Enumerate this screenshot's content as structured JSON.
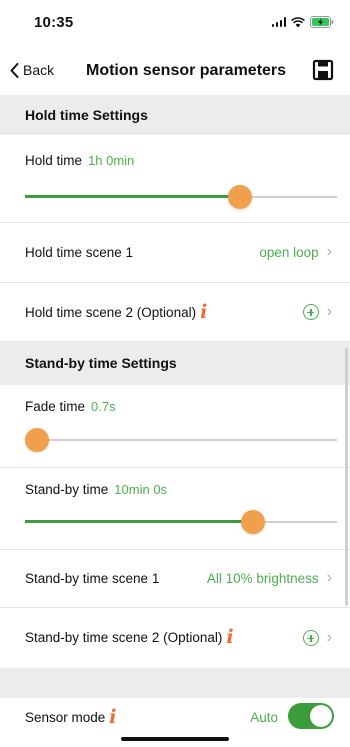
{
  "status_bar": {
    "time": "10:35"
  },
  "nav": {
    "back_label": "Back",
    "title": "Motion sensor parameters",
    "save_icon": "floppy-disk-icon"
  },
  "hold_section": {
    "header": "Hold time Settings",
    "hold_time": {
      "label": "Hold time",
      "value": "1h 0min",
      "slider_fraction": 0.69
    },
    "scene1": {
      "label": "Hold time scene 1",
      "value": "open loop"
    },
    "scene2": {
      "label": "Hold time scene 2 (Optional)"
    }
  },
  "standby_section": {
    "header": "Stand-by time Settings",
    "fade_time": {
      "label": "Fade time",
      "value": "0.7s",
      "slider_fraction": 0.0
    },
    "standby_time": {
      "label": "Stand-by time",
      "value": "10min 0s",
      "slider_fraction": 0.73
    },
    "scene1": {
      "label": "Stand-by time scene 1",
      "value": "All 10% brightness"
    },
    "scene2": {
      "label": "Stand-by time scene 2 (Optional)"
    }
  },
  "sensor_mode": {
    "label": "Sensor mode",
    "value": "Auto",
    "toggle_on": true
  },
  "colors": {
    "accent": "#4caf50",
    "thumb": "#f0a04b",
    "info": "#e96d2c",
    "section_bg": "#ececec"
  },
  "icons": {
    "info": "i",
    "chevron": "›"
  }
}
